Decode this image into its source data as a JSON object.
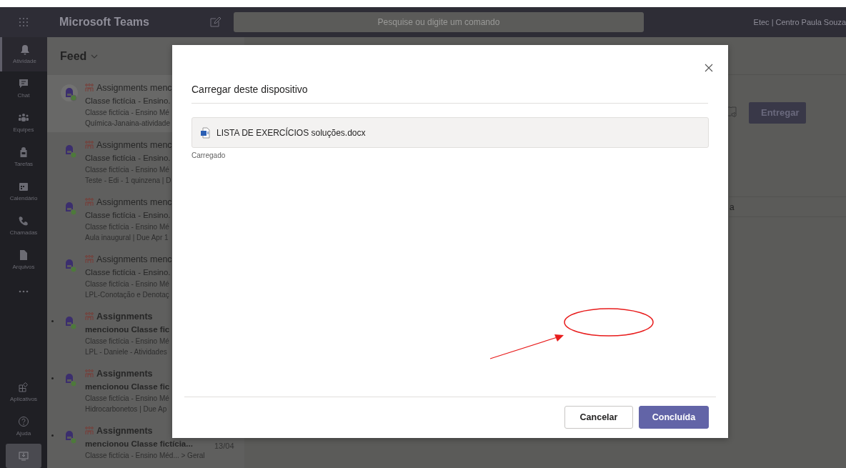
{
  "app_bar": {
    "title": "Microsoft Teams",
    "search_placeholder": "Pesquise ou digite um comando",
    "org": "Etec | Centro Paula Souza"
  },
  "rail": [
    {
      "kind": "bell",
      "label": "Atividade",
      "selected": true
    },
    {
      "kind": "chat",
      "label": "Chat",
      "selected": false
    },
    {
      "kind": "teams",
      "label": "Equipes",
      "selected": false
    },
    {
      "kind": "bag",
      "label": "Tarefas",
      "selected": false
    },
    {
      "kind": "calendar",
      "label": "Calendário",
      "selected": false
    },
    {
      "kind": "phone",
      "label": "Chamadas",
      "selected": false
    },
    {
      "kind": "file",
      "label": "Arquivos",
      "selected": false
    },
    {
      "kind": "more"
    },
    {
      "kind": "apps",
      "label": "Aplicativos",
      "selected": false
    },
    {
      "kind": "help",
      "label": "Ajuda",
      "selected": false
    },
    {
      "kind": "download"
    }
  ],
  "feed": {
    "title": "Feed",
    "items": [
      {
        "unread": false,
        "selected": true,
        "title": "Assignments menc",
        "line2": "Classe fictícia - Ensino.",
        "line3": "Classe fictícia - Ensino Mé",
        "line4": "Química-Janaina-atividade"
      },
      {
        "unread": false,
        "selected": false,
        "title": "Assignments menc",
        "line2": "Classe fictícia - Ensino.",
        "line3": "Classe fictícia - Ensino Mé",
        "line4": "Teste - Edi - 1 quinzena | D"
      },
      {
        "unread": false,
        "selected": false,
        "title": "Assignments menc",
        "line2": "Classe fictícia - Ensino.",
        "line3": "Classe fictícia - Ensino Mé",
        "line4": "Aula inaugural | Due Apr 1"
      },
      {
        "unread": false,
        "selected": false,
        "title": "Assignments menc",
        "line2": "Classe fictícia - Ensino.",
        "line3": "Classe fictícia - Ensino Mé",
        "line4": "LPL-Conotação e Denotaç"
      },
      {
        "unread": true,
        "selected": false,
        "title": "Assignments",
        "line2": "mencionou Classe fic",
        "line3": "Classe fictícia - Ensino Mé",
        "line4": "LPL - Daniele - Atividades"
      },
      {
        "unread": true,
        "selected": false,
        "title": "Assignments",
        "line2": "mencionou Classe fic",
        "line3": "Classe fictícia - Ensino Mé",
        "line4": "Hidrocarbonetos | Due Ap"
      },
      {
        "unread": true,
        "selected": false,
        "title": "Assignments",
        "date": "13/04",
        "line2": "mencionou Classe fictícia...",
        "line3": "Classe fictícia - Ensino Méd... > Geral"
      }
    ]
  },
  "content": {
    "submit_button": "Entregar",
    "row_text": "a"
  },
  "dialog": {
    "title": "Carregar deste dispositivo",
    "file": {
      "name": "LISTA DE EXERCÍCIOS soluções.docx",
      "status": "Carregado"
    },
    "buttons": [
      {
        "label": "Cancelar",
        "kind": "secondary"
      },
      {
        "label": "Concluída",
        "kind": "primary"
      }
    ]
  }
}
